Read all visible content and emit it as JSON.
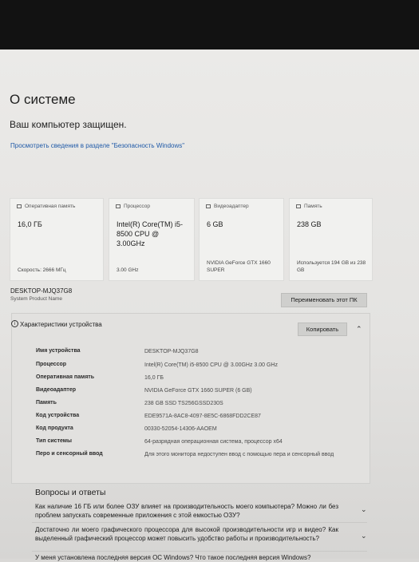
{
  "page": {
    "title": "О системе",
    "protection_status": "Ваш компьютер защищен.",
    "security_link": "Просмотреть сведения в разделе \"Безопасность Windows\""
  },
  "cards": [
    {
      "icon": "memory-icon",
      "header": "Оперативная память",
      "value": "16,0 ГБ",
      "sub": "Скорость: 2666 МГц"
    },
    {
      "icon": "processor-icon",
      "header": "Процессор",
      "value": "Intel(R) Core(TM) i5-8500 CPU @ 3.00GHz",
      "sub": "3.00 GHz"
    },
    {
      "icon": "display-adapter-icon",
      "header": "Видеоадаптер",
      "value": "6 GB",
      "sub": "NVIDIA GeForce GTX 1660 SUPER"
    },
    {
      "icon": "storage-icon",
      "header": "Память",
      "value": "238 GB",
      "sub": "Используется 194 GB из 238 GB"
    }
  ],
  "device": {
    "name": "DESKTOP-MJQ37G8",
    "model": "System Product Name",
    "rename_button": "Переименовать этот ПК"
  },
  "specs": {
    "header": "Характеристики устройства",
    "copy_button": "Копировать",
    "rows": [
      {
        "label": "Имя устройства",
        "value": "DESKTOP-MJQ37G8"
      },
      {
        "label": "Процессор",
        "value": "Intel(R) Core(TM) i5-8500 CPU @ 3.00GHz   3.00 GHz"
      },
      {
        "label": "Оперативная память",
        "value": "16,0 ГБ"
      },
      {
        "label": "Видеоадаптер",
        "value": "NVIDIA GeForce GTX 1660 SUPER (6 GB)"
      },
      {
        "label": "Память",
        "value": "238 GB SSD TS256GSSD230S"
      },
      {
        "label": "Код устройства",
        "value": "EDE9571A-8AC8-4097-8E5C-6868FDD2CE87"
      },
      {
        "label": "Код продукта",
        "value": "00330-52054-14306-AAOEM"
      },
      {
        "label": "Тип системы",
        "value": "64-разрядная операционная система, процессор x64"
      },
      {
        "label": "Перо и сенсорный ввод",
        "value": "Для этого монитора недоступен ввод с помощью пера и сенсорный ввод"
      }
    ]
  },
  "qa": {
    "title": "Вопросы и ответы",
    "questions": [
      "Как наличие 16 ГБ или более ОЗУ влияет на производительность моего компьютера? Можно ли без проблем запускать современные приложения с этой емкостью ОЗУ?",
      "Достаточно ли моего графического процессора для высокой производительности игр и видео? Как выделенный графический процессор может повысить удобство работы и производительность?",
      "У меня установлена последняя версия ОС Windows? Что такое последняя версия Windows?"
    ]
  }
}
